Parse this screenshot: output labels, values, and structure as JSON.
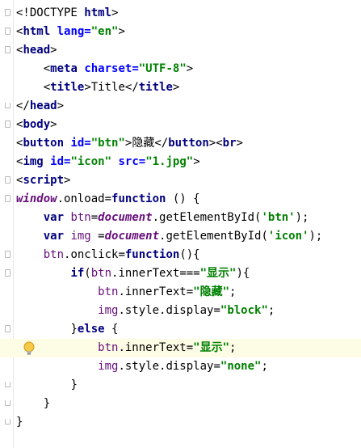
{
  "editor": {
    "lines": [
      {
        "indent": "",
        "tokens": [
          {
            "t": "<!DOCTYPE ",
            "c": "plain"
          },
          {
            "t": "html",
            "c": "tag"
          },
          {
            "t": ">",
            "c": "plain"
          }
        ],
        "fold": "start"
      },
      {
        "indent": "",
        "tokens": [
          {
            "t": "<",
            "c": "plain"
          },
          {
            "t": "html ",
            "c": "tag"
          },
          {
            "t": "lang=",
            "c": "attr"
          },
          {
            "t": "\"en\"",
            "c": "str"
          },
          {
            "t": ">",
            "c": "plain"
          }
        ],
        "fold": "start"
      },
      {
        "indent": "",
        "tokens": [
          {
            "t": "<",
            "c": "plain"
          },
          {
            "t": "head",
            "c": "tag"
          },
          {
            "t": ">",
            "c": "plain"
          }
        ],
        "fold": "start"
      },
      {
        "indent": "    ",
        "tokens": [
          {
            "t": "<",
            "c": "plain"
          },
          {
            "t": "meta ",
            "c": "tag"
          },
          {
            "t": "charset=",
            "c": "attr"
          },
          {
            "t": "\"UTF-8\"",
            "c": "str"
          },
          {
            "t": ">",
            "c": "plain"
          }
        ]
      },
      {
        "indent": "    ",
        "tokens": [
          {
            "t": "<",
            "c": "plain"
          },
          {
            "t": "title",
            "c": "tag"
          },
          {
            "t": ">Title</",
            "c": "plain"
          },
          {
            "t": "title",
            "c": "tag"
          },
          {
            "t": ">",
            "c": "plain"
          }
        ]
      },
      {
        "indent": "",
        "tokens": [
          {
            "t": "</",
            "c": "plain"
          },
          {
            "t": "head",
            "c": "tag"
          },
          {
            "t": ">",
            "c": "plain"
          }
        ],
        "fold": "end"
      },
      {
        "indent": "",
        "tokens": [
          {
            "t": "<",
            "c": "plain"
          },
          {
            "t": "body",
            "c": "tag"
          },
          {
            "t": ">",
            "c": "plain"
          }
        ],
        "fold": "start"
      },
      {
        "indent": "",
        "tokens": [
          {
            "t": "<",
            "c": "plain"
          },
          {
            "t": "button ",
            "c": "tag"
          },
          {
            "t": "id=",
            "c": "attr"
          },
          {
            "t": "\"btn\"",
            "c": "str"
          },
          {
            "t": ">隐藏</",
            "c": "plain"
          },
          {
            "t": "button",
            "c": "tag"
          },
          {
            "t": "><",
            "c": "plain"
          },
          {
            "t": "br",
            "c": "tag"
          },
          {
            "t": ">",
            "c": "plain"
          }
        ]
      },
      {
        "indent": "",
        "tokens": [
          {
            "t": "<",
            "c": "plain"
          },
          {
            "t": "img ",
            "c": "tag"
          },
          {
            "t": "id=",
            "c": "attr"
          },
          {
            "t": "\"icon\" ",
            "c": "str"
          },
          {
            "t": "src=",
            "c": "attr"
          },
          {
            "t": "\"1.jpg\"",
            "c": "str"
          },
          {
            "t": ">",
            "c": "plain"
          }
        ]
      },
      {
        "indent": "",
        "tokens": [
          {
            "t": "<",
            "c": "plain"
          },
          {
            "t": "script",
            "c": "tag"
          },
          {
            "t": ">",
            "c": "plain"
          }
        ],
        "fold": "start"
      },
      {
        "indent": "",
        "tokens": [
          {
            "t": "window",
            "c": "glob"
          },
          {
            "t": ".onload=",
            "c": "plain"
          },
          {
            "t": "function ",
            "c": "kw"
          },
          {
            "t": "() {",
            "c": "plain"
          }
        ],
        "fold": "start"
      },
      {
        "indent": "    ",
        "tokens": [
          {
            "t": "var ",
            "c": "kw"
          },
          {
            "t": "btn",
            "c": "prop"
          },
          {
            "t": "=",
            "c": "plain"
          },
          {
            "t": "document",
            "c": "glob"
          },
          {
            "t": ".getElementById(",
            "c": "plain"
          },
          {
            "t": "'btn'",
            "c": "str"
          },
          {
            "t": ");",
            "c": "plain"
          }
        ]
      },
      {
        "indent": "    ",
        "tokens": [
          {
            "t": "var ",
            "c": "kw"
          },
          {
            "t": "img ",
            "c": "prop"
          },
          {
            "t": "=",
            "c": "plain"
          },
          {
            "t": "document",
            "c": "glob"
          },
          {
            "t": ".getElementById(",
            "c": "plain"
          },
          {
            "t": "'icon'",
            "c": "str"
          },
          {
            "t": ");",
            "c": "plain"
          }
        ]
      },
      {
        "indent": "    ",
        "tokens": [
          {
            "t": "btn",
            "c": "prop"
          },
          {
            "t": ".onclick=",
            "c": "plain"
          },
          {
            "t": "function",
            "c": "kw"
          },
          {
            "t": "(){",
            "c": "plain"
          }
        ],
        "fold": "start"
      },
      {
        "indent": "        ",
        "tokens": [
          {
            "t": "if",
            "c": "kw"
          },
          {
            "t": "(",
            "c": "plain"
          },
          {
            "t": "btn",
            "c": "prop"
          },
          {
            "t": ".innerText===",
            "c": "plain"
          },
          {
            "t": "\"显示\"",
            "c": "str"
          },
          {
            "t": "){",
            "c": "plain"
          }
        ],
        "fold": "start"
      },
      {
        "indent": "            ",
        "tokens": [
          {
            "t": "btn",
            "c": "prop"
          },
          {
            "t": ".innerText=",
            "c": "plain"
          },
          {
            "t": "\"隐藏\"",
            "c": "str"
          },
          {
            "t": ";",
            "c": "plain"
          }
        ]
      },
      {
        "indent": "            ",
        "tokens": [
          {
            "t": "img",
            "c": "prop"
          },
          {
            "t": ".style.display=",
            "c": "plain"
          },
          {
            "t": "\"block\"",
            "c": "str"
          },
          {
            "t": ";",
            "c": "plain"
          }
        ]
      },
      {
        "indent": "        ",
        "tokens": [
          {
            "t": "}",
            "c": "plain"
          },
          {
            "t": "else ",
            "c": "kw"
          },
          {
            "t": "{",
            "c": "plain"
          }
        ],
        "fold": "start"
      },
      {
        "indent": "            ",
        "tokens": [
          {
            "t": "btn",
            "c": "prop"
          },
          {
            "t": ".innerText=",
            "c": "plain"
          },
          {
            "t": "\"显示\"",
            "c": "str"
          },
          {
            "t": ";",
            "c": "plain"
          }
        ],
        "highlight": true,
        "bulb": true
      },
      {
        "indent": "            ",
        "tokens": [
          {
            "t": "img",
            "c": "prop"
          },
          {
            "t": ".style.display=",
            "c": "plain"
          },
          {
            "t": "\"none\"",
            "c": "str"
          },
          {
            "t": ";",
            "c": "plain"
          }
        ]
      },
      {
        "indent": "        ",
        "tokens": [
          {
            "t": "}",
            "c": "plain"
          }
        ],
        "fold": "end"
      },
      {
        "indent": "    ",
        "tokens": [
          {
            "t": "}",
            "c": "plain"
          }
        ],
        "fold": "end"
      },
      {
        "indent": "",
        "tokens": [
          {
            "t": "}",
            "c": "plain"
          }
        ],
        "fold": "end"
      }
    ]
  },
  "colors": {
    "tag": "#000080",
    "attribute": "#0000ff",
    "string": "#008000",
    "keyword": "#000080",
    "global": "#660e7a",
    "highlight_line": "#fdfce5"
  },
  "icons": {
    "bulb": "lightbulb-icon",
    "fold": "fold-marker-icon"
  }
}
